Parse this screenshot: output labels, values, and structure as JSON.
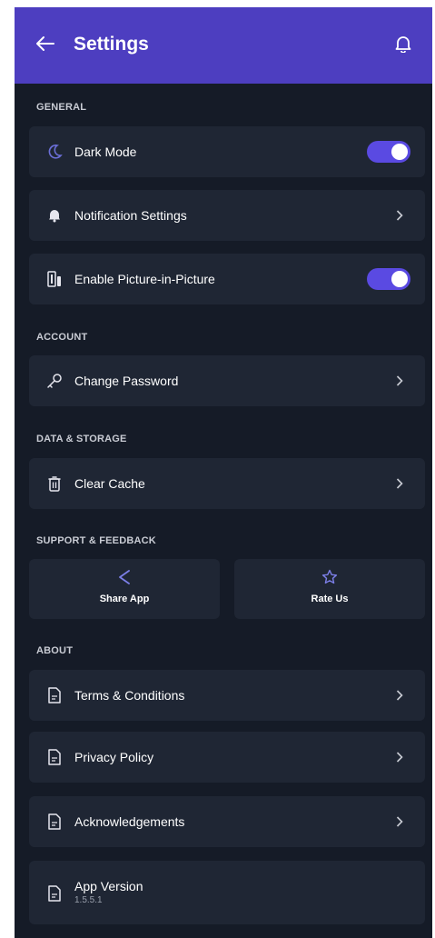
{
  "header": {
    "title": "Settings",
    "back_icon": "arrow-left-icon",
    "bell_icon": "bell-icon",
    "color": "#4d3ec0"
  },
  "sections": {
    "general": "GENERAL",
    "account": "ACCOUNT",
    "data_storage": "DATA & STORAGE",
    "support": "SUPPORT & FEEDBACK",
    "about": "ABOUT"
  },
  "general": {
    "dark_mode": {
      "label": "Dark Mode",
      "icon": "moon-icon",
      "enabled": true
    },
    "notifications": {
      "label": "Notification Settings",
      "icon": "notification-bell-icon"
    },
    "pip": {
      "label": "Enable Picture-in-Picture",
      "icon": "picture-in-picture-icon",
      "enabled": true
    }
  },
  "account": {
    "change_password": {
      "label": "Change Password",
      "icon": "key-icon"
    }
  },
  "data_storage": {
    "clear_cache": {
      "label": "Clear Cache",
      "icon": "trash-icon"
    }
  },
  "support": {
    "share": {
      "label": "Share App",
      "icon": "share-icon"
    },
    "rate": {
      "label": "Rate Us",
      "icon": "star-icon"
    }
  },
  "about": {
    "terms": {
      "label": "Terms & Conditions",
      "icon": "document-icon"
    },
    "privacy": {
      "label": "Privacy Policy",
      "icon": "document-icon"
    },
    "ack": {
      "label": "Acknowledgements",
      "icon": "document-icon"
    },
    "version": {
      "label": "App Version",
      "value": "1.5.5.1",
      "icon": "document-icon"
    }
  },
  "colors": {
    "background": "#151b27",
    "card": "#1f2634",
    "accent": "#5a4ae2"
  }
}
